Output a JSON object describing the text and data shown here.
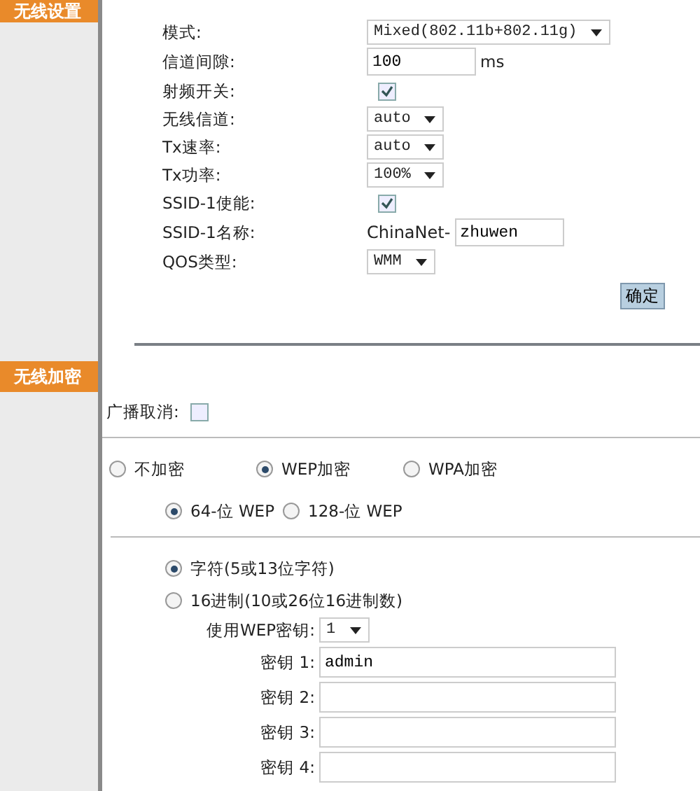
{
  "sections": [
    {
      "title": "无线设置"
    },
    {
      "title": "无线加密"
    }
  ],
  "wireless_settings": {
    "rows": [
      {
        "label": "模式:",
        "kind": "select",
        "value": "Mixed(802.11b+802.11g)"
      },
      {
        "label": "信道间隙:",
        "kind": "input",
        "value": "100",
        "unit": "ms"
      },
      {
        "label": "射频开关:",
        "kind": "checkbox",
        "checked": true
      },
      {
        "label": "无线信道:",
        "kind": "select",
        "value": "auto"
      },
      {
        "label": "Tx速率:",
        "kind": "select",
        "value": "auto"
      },
      {
        "label": "Tx功率:",
        "kind": "select",
        "value": "100%"
      },
      {
        "label": "SSID-1使能:",
        "kind": "checkbox",
        "checked": true
      },
      {
        "label": "SSID-1名称:",
        "kind": "prefixed_input",
        "prefix": "ChinaNet-",
        "value": "zhuwen"
      },
      {
        "label": "QOS类型:",
        "kind": "select",
        "value": "WMM"
      }
    ],
    "submit": "确定"
  },
  "encryption": {
    "broadcast_cancel": {
      "label": "广播取消:",
      "checked": false
    },
    "modes": [
      {
        "label": "不加密",
        "selected": false
      },
      {
        "label": "WEP加密",
        "selected": true
      },
      {
        "label": "WPA加密",
        "selected": false
      }
    ],
    "key_lengths": [
      {
        "label": "64-位 WEP",
        "selected": true
      },
      {
        "label": "128-位 WEP",
        "selected": false
      }
    ],
    "key_formats": [
      {
        "label": "字符(5或13位字符)",
        "selected": true
      },
      {
        "label": "16进制(10或26位16进制数)",
        "selected": false
      }
    ],
    "active_key": {
      "label": "使用WEP密钥:",
      "value": "1"
    },
    "keys": [
      {
        "label": "密钥 1:",
        "value": "admin"
      },
      {
        "label": "密钥 2:"
      },
      {
        "label": "密钥 3:"
      },
      {
        "label": "密钥 4:"
      }
    ]
  }
}
